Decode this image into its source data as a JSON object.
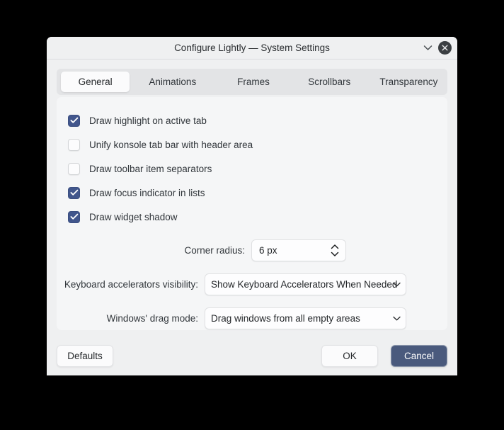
{
  "window": {
    "title": "Configure Lightly — System Settings",
    "menu_icon": "chevron-down-icon",
    "close_icon": "close-circle-icon"
  },
  "tabs": [
    {
      "label": "General",
      "active": true
    },
    {
      "label": "Animations",
      "active": false
    },
    {
      "label": "Frames",
      "active": false
    },
    {
      "label": "Scrollbars",
      "active": false
    },
    {
      "label": "Transparency",
      "active": false
    }
  ],
  "checkboxes": [
    {
      "label": "Draw highlight on active tab",
      "checked": true
    },
    {
      "label": "Unify konsole tab bar with header area",
      "checked": false
    },
    {
      "label": "Draw toolbar item separators",
      "checked": false
    },
    {
      "label": "Draw focus indicator in lists",
      "checked": true
    },
    {
      "label": "Draw widget shadow",
      "checked": true
    }
  ],
  "fields": {
    "corner_radius": {
      "label": "Corner radius:",
      "value": "6 px",
      "stepper_icon": "up-down-stepper-icon"
    },
    "keyboard_accelerators": {
      "label": "Keyboard accelerators visibility:",
      "value": "Show Keyboard Accelerators When Needed",
      "arrow_icon": "chevron-down-icon"
    },
    "windows_drag_mode": {
      "label": "Windows' drag mode:",
      "value": "Drag windows from all empty areas",
      "arrow_icon": "chevron-down-icon"
    }
  },
  "footer": {
    "defaults_label": "Defaults",
    "ok_label": "OK",
    "cancel_label": "Cancel"
  },
  "colors": {
    "accent_checkbox": "#41568c",
    "cancel_button": "#4a5a7d",
    "window_background": "#eff0f1",
    "panel_background": "#f5f6f7",
    "tabbar_background": "#e3e4e6",
    "desktop_background": "#000000"
  }
}
